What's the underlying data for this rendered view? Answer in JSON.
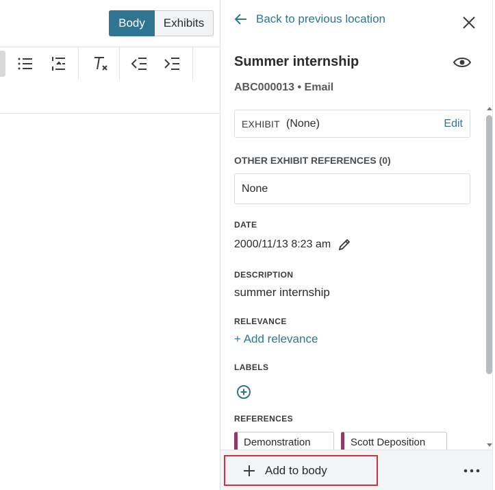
{
  "editor": {
    "view_toggle": {
      "body_label": "Body",
      "exhibits_label": "Exhibits"
    },
    "toolbar_icons": [
      "bulleted-list-icon",
      "numbered-list-icon",
      "clear-formatting-icon",
      "outdent-icon",
      "indent-icon"
    ]
  },
  "panel": {
    "back_label": "Back to previous location",
    "title": "Summer internship",
    "subtitle": "ABC000013 • Email",
    "exhibit": {
      "label": "EXHIBIT",
      "value": "(None)",
      "edit_label": "Edit"
    },
    "other_refs": {
      "label": "OTHER EXHIBIT REFERENCES (0)",
      "value": "None"
    },
    "date": {
      "label": "DATE",
      "value": "2000/11/13 8:23 am"
    },
    "description": {
      "label": "DESCRIPTION",
      "value": "summer internship"
    },
    "relevance": {
      "label": "RELEVANCE",
      "add_label": "+ Add relevance"
    },
    "labels": {
      "label": "LABELS"
    },
    "references": {
      "label": "REFERENCES",
      "items": [
        "Demonstration",
        "Scott Deposition"
      ]
    },
    "footer": {
      "add_body_label": "Add to body"
    }
  },
  "colors": {
    "accent": "#2f7591",
    "highlight_border": "#cc3340",
    "reference_marker": "#8e3a64"
  }
}
